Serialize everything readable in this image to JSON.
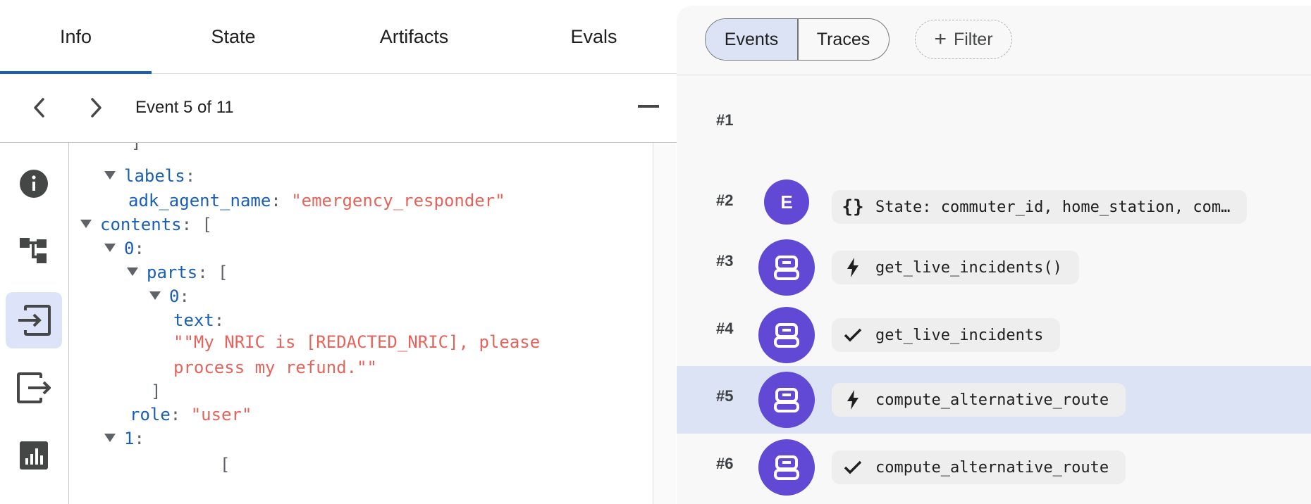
{
  "tabs": [
    {
      "label": "Info",
      "active": true
    },
    {
      "label": "State",
      "active": false
    },
    {
      "label": "Artifacts",
      "active": false
    },
    {
      "label": "Evals",
      "active": false
    }
  ],
  "event_nav": {
    "label": "Event 5 of 11"
  },
  "json_view": {
    "bracket_close": "]",
    "labels_key": "labels",
    "adk_key": "adk_agent_name",
    "adk_val": "\"emergency_responder\"",
    "contents_key": "contents",
    "open_bracket": "[",
    "idx0": "0",
    "parts_key": "parts",
    "text_key": "text",
    "text_line1": "\"\"My NRIC is [REDACTED_NRIC], please",
    "text_line2": "process my refund.\"\"",
    "role_key": "role",
    "role_val": "\"user\"",
    "idx1": "1",
    "colon": ":"
  },
  "toolbar": {
    "events_label": "Events",
    "traces_label": "Traces",
    "filter_label": "Filter",
    "filter_icon": "+"
  },
  "events": [
    {
      "num": "#1"
    },
    {
      "num": "#2",
      "avatar": "E",
      "chip_icon": "{}",
      "chip_text": "State: commuter_id, home_station, com…"
    },
    {
      "num": "#3",
      "avatar_icon": "robot",
      "chip_icon": "bolt",
      "chip_text": "get_live_incidents()"
    },
    {
      "num": "#4",
      "avatar_icon": "robot",
      "chip_icon": "check",
      "chip_text": "get_live_incidents"
    },
    {
      "num": "#5",
      "avatar_icon": "robot",
      "chip_icon": "bolt",
      "chip_text": "compute_alternative_route",
      "selected": true
    },
    {
      "num": "#6",
      "avatar_icon": "robot",
      "chip_icon": "check",
      "chip_text": "compute_alternative_route"
    }
  ],
  "colors": {
    "accent": "#1a5fb4",
    "avatar": "#6149d6",
    "selected_row": "#dbe3f5",
    "json_key": "#1a5fb4",
    "json_string": "#e4645b"
  }
}
